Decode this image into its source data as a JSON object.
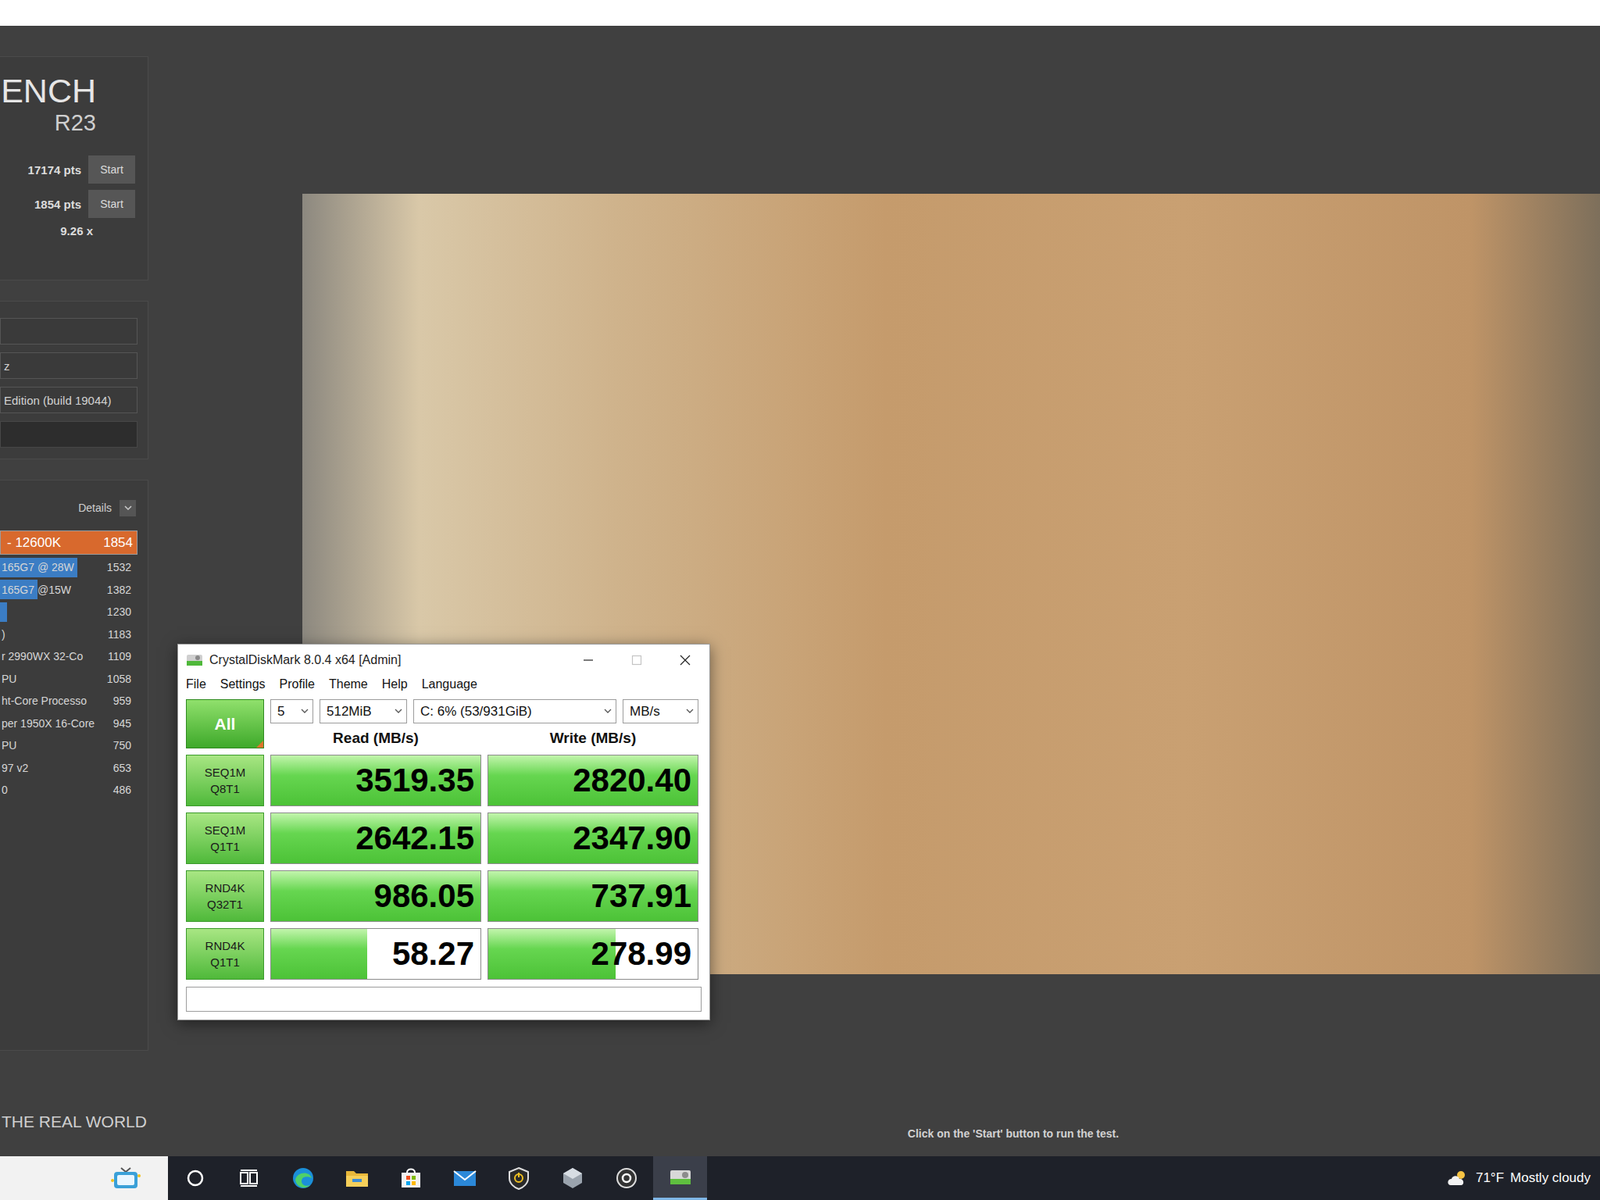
{
  "cinebench": {
    "logo": "ENCH",
    "version": "R23",
    "scores": [
      {
        "value": "17174 pts",
        "button": "Start"
      },
      {
        "value": "1854 pts",
        "button": "Start"
      }
    ],
    "ratio": "9.26 x",
    "fields": [
      {
        "value": "",
        "kind": "text"
      },
      {
        "value": "z",
        "kind": "text"
      },
      {
        "value": "Edition (build 19044)",
        "kind": "text"
      },
      {
        "value": "",
        "kind": "dark"
      }
    ],
    "details": "Details",
    "ranking": [
      {
        "name": "- 12600K",
        "score": "1854",
        "level": 1,
        "selected": true
      },
      {
        "name": "165G7 @ 28W",
        "score": "1532",
        "level": 0.56,
        "selected": false
      },
      {
        "name": "165G7 @15W",
        "score": "1382",
        "level": 0.27,
        "selected": false
      },
      {
        "name": "",
        "score": "1230",
        "level": 0.05,
        "selected": false
      },
      {
        "name": ")",
        "score": "1183",
        "level": 0,
        "selected": false
      },
      {
        "name": "r 2990WX 32-Co",
        "score": "1109",
        "level": 0,
        "selected": false
      },
      {
        "name": "PU",
        "score": "1058",
        "level": 0,
        "selected": false
      },
      {
        "name": "ht-Core Processo",
        "score": "959",
        "level": 0,
        "selected": false
      },
      {
        "name": "per 1950X 16-Core",
        "score": "945",
        "level": 0,
        "selected": false
      },
      {
        "name": "PU",
        "score": "750",
        "level": 0,
        "selected": false
      },
      {
        "name": "97 v2",
        "score": "653",
        "level": 0,
        "selected": false
      },
      {
        "name": "0",
        "score": "486",
        "level": 0,
        "selected": false
      }
    ],
    "tagline": "THE REAL WORLD",
    "hint": "Click on the 'Start' button to run the test."
  },
  "crystaldiskmark": {
    "title": "CrystalDiskMark 8.0.4 x64 [Admin]",
    "menu": [
      "File",
      "Settings",
      "Profile",
      "Theme",
      "Help",
      "Language"
    ],
    "all_button": "All",
    "selectors": [
      {
        "value": "5",
        "kind": "count"
      },
      {
        "value": "512MiB",
        "kind": "size"
      },
      {
        "value": "C: 6% (53/931GiB)",
        "kind": "drive"
      },
      {
        "value": "MB/s",
        "kind": "unit"
      }
    ],
    "columns": [
      "Read (MB/s)",
      "Write (MB/s)"
    ],
    "rows": [
      {
        "test": "SEQ1M",
        "queue": "Q8T1",
        "read": "3519.35",
        "read_level": 1,
        "write": "2820.40",
        "write_level": 1
      },
      {
        "test": "SEQ1M",
        "queue": "Q1T1",
        "read": "2642.15",
        "read_level": 1,
        "write": "2347.90",
        "write_level": 1
      },
      {
        "test": "RND4K",
        "queue": "Q32T1",
        "read": "986.05",
        "read_level": 1,
        "write": "737.91",
        "write_level": 1
      },
      {
        "test": "RND4K",
        "queue": "Q1T1",
        "read": "58.27",
        "read_level": 0.46,
        "write": "278.99",
        "write_level": 0.61
      }
    ],
    "comment": ""
  },
  "taskbar": {
    "apps": [
      {
        "kind": "search",
        "selected": false
      },
      {
        "kind": "cortana",
        "selected": false
      },
      {
        "kind": "taskview",
        "selected": false
      },
      {
        "kind": "edge",
        "selected": false
      },
      {
        "kind": "explorer",
        "selected": false
      },
      {
        "kind": "store",
        "selected": false
      },
      {
        "kind": "mail",
        "selected": false
      },
      {
        "kind": "shield",
        "selected": false
      },
      {
        "kind": "hexagon",
        "selected": false
      },
      {
        "kind": "ring",
        "selected": false
      },
      {
        "kind": "diskmark",
        "selected": true
      }
    ],
    "weather": {
      "temperature": "71°F",
      "condition": "Mostly cloudy"
    }
  }
}
